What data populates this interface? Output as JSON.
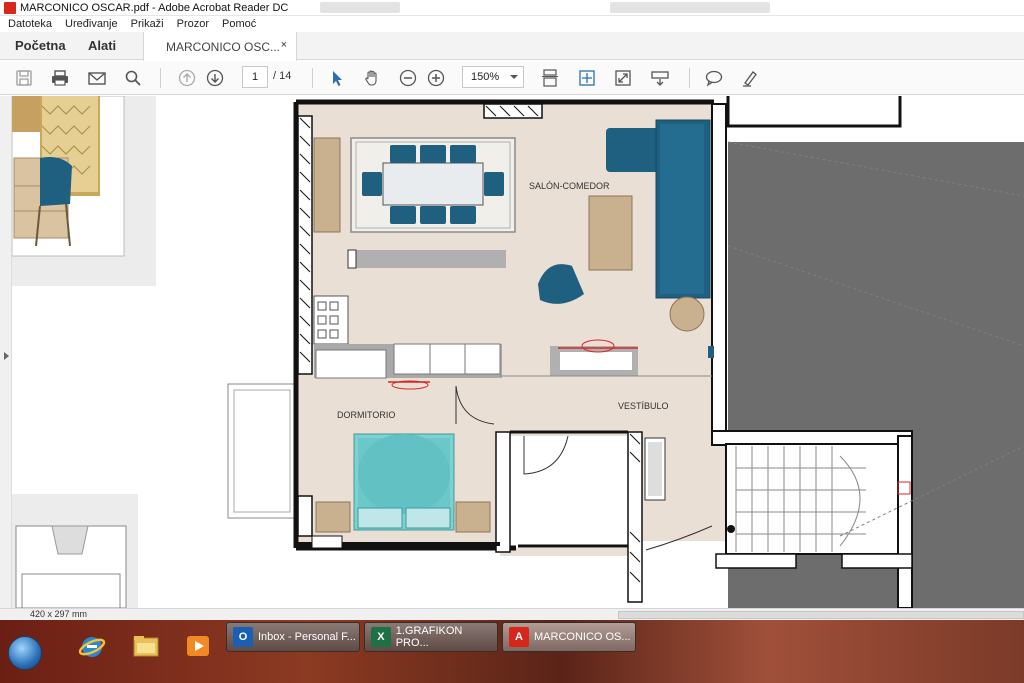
{
  "window": {
    "title": "MARCONICO OSCAR.pdf - Adobe Acrobat Reader DC"
  },
  "menu": [
    "Datoteka",
    "Uređivanje",
    "Prikaži",
    "Prozor",
    "Pomoć"
  ],
  "tabs": {
    "home": "Početna",
    "tools": "Alati",
    "document": "MARCONICO OSC...",
    "close": "×"
  },
  "toolbar": {
    "page_current": "1",
    "page_total": "/ 14",
    "zoom": "150%",
    "icons": [
      "save-icon",
      "print-icon",
      "email-icon",
      "search-icon",
      "page-up-icon",
      "page-down-icon",
      "select-arrow-icon",
      "hand-icon",
      "zoom-out-icon",
      "zoom-in-icon",
      "scroll-mode-icon",
      "fit-page-icon",
      "fullscreen-icon",
      "read-mode-icon",
      "comment-icon",
      "highlight-icon"
    ]
  },
  "document": {
    "rooms": {
      "living": "SALÓN-COMEDOR",
      "bedroom": "DORMITORIO",
      "hall": "VESTÍBULO"
    }
  },
  "status": {
    "page_size": "420 x 297 mm"
  },
  "taskbar": {
    "items": [
      {
        "label": "Inbox - Personal F...",
        "icon": "outlook-icon"
      },
      {
        "label": "1.GRAFIKON PRO...",
        "icon": "excel-icon"
      },
      {
        "label": "MARCONICO OS...",
        "icon": "pdf-icon"
      }
    ],
    "pinned": [
      "internet-explorer-icon",
      "file-explorer-icon",
      "media-player-icon"
    ]
  },
  "colors": {
    "accent_blue": "#1f5f7f",
    "floor_beige": "#e9dfd4",
    "acrobat_red": "#d9261c"
  }
}
